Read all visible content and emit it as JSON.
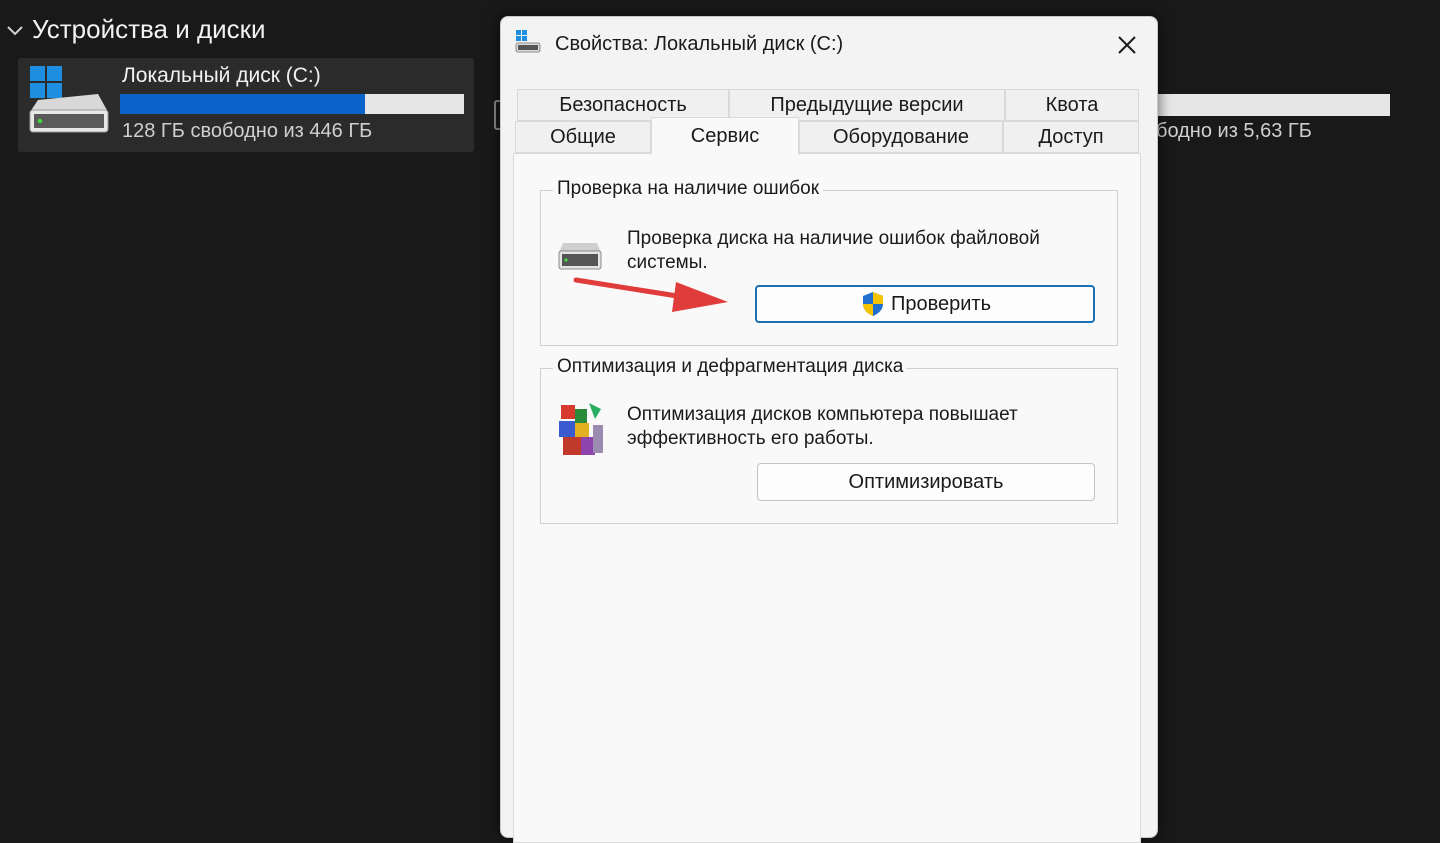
{
  "explorer": {
    "section_title": "Устройства и диски",
    "drive_c": {
      "name": "Локальный диск (C:)",
      "free_text": "128 ГБ свободно из 446 ГБ",
      "used_fraction": 0.713
    },
    "drive_2": {
      "free_text": "бодно из 5,63 ГБ"
    }
  },
  "dialog": {
    "title": "Свойства: Локальный диск (C:)",
    "tabs_top": [
      "Безопасность",
      "Предыдущие версии",
      "Квота"
    ],
    "tabs_bottom": [
      "Общие",
      "Сервис",
      "Оборудование",
      "Доступ"
    ],
    "active_tab": "Сервис",
    "error_check": {
      "legend": "Проверка на наличие ошибок",
      "description": "Проверка диска на наличие ошибок файловой системы.",
      "button": "Проверить"
    },
    "optimize": {
      "legend": "Оптимизация и дефрагментация диска",
      "description": "Оптимизация дисков компьютера повышает эффективность его работы.",
      "button": "Оптимизировать"
    }
  },
  "colors": {
    "accent": "#0b63c9",
    "annotation_arrow": "#e03c3c",
    "shield_blue": "#1e6fd0",
    "shield_yellow": "#f5c400"
  }
}
